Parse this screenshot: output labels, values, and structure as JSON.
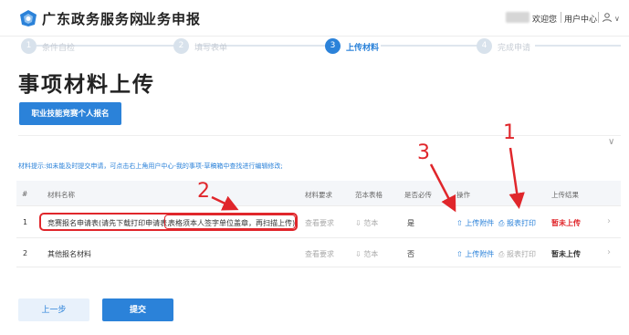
{
  "header": {
    "site_title": "广东政务服务网",
    "site_sub": "业务申报",
    "welcome": "欢迎您",
    "user_center": "用户中心",
    "caret": "∨"
  },
  "steps": [
    {
      "num": "1",
      "label": "条件自检"
    },
    {
      "num": "2",
      "label": "填写表单"
    },
    {
      "num": "3",
      "label": "上传材料"
    },
    {
      "num": "4",
      "label": "完成申请"
    }
  ],
  "page_title": "事项材料上传",
  "vocational_button": "职业技能竞赛个人报名",
  "collapse": "∨",
  "tip": "材料提示:如未能及时提交申请，可点击右上角用户中心-我的事项-草稿箱中查找进行编辑修改;",
  "table": {
    "headers": {
      "index": "#",
      "name": "材料名称",
      "requirement": "材料要求",
      "template": "范本表格",
      "required": "是否必传",
      "operation": "操作",
      "result": "上传结果"
    },
    "rows": [
      {
        "index": "1",
        "name_main": "竞赛报名申请表(请先下载打印申请表,",
        "name_note": "表格须本人签字单位盖章，再扫描上传)",
        "requirement": "查看要求",
        "template": "⇩ 范本",
        "required": "是",
        "upload": "⇧ 上传附件",
        "print": "⎙ 报表打印",
        "result": "暂未上传",
        "arrow": "›"
      },
      {
        "index": "2",
        "name_main": "其他报名材料",
        "requirement": "查看要求",
        "template": "⇩ 范本",
        "required": "否",
        "upload": "⇧ 上传附件",
        "print": "⎙ 报表打印",
        "result": "暂未上传",
        "arrow": "›"
      }
    ]
  },
  "annotations": {
    "a1": "1",
    "a2": "2",
    "a3": "3"
  },
  "buttons": {
    "prev": "上一步",
    "submit": "提交"
  },
  "colors": {
    "primary": "#2b82d9",
    "annotation": "#e0262b"
  }
}
